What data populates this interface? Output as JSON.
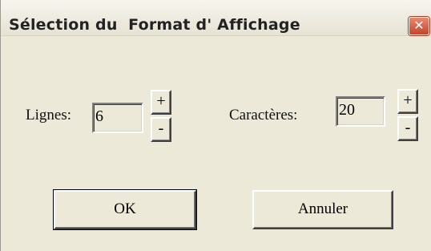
{
  "window": {
    "title": "Sélection du  Format d' Affichage",
    "close_glyph": "✕"
  },
  "lignes": {
    "label": "Lignes:",
    "value": "6",
    "plus": "+",
    "minus": "-"
  },
  "caracteres": {
    "label": "Caractères:",
    "value": "20",
    "plus": "+",
    "minus": "-"
  },
  "buttons": {
    "ok": "OK",
    "cancel": "Annuler"
  }
}
